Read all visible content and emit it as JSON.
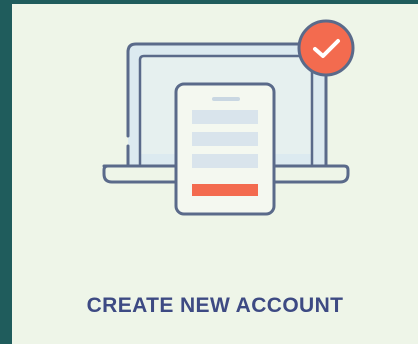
{
  "card": {
    "title": "CREATE NEW ACCOUNT",
    "illustration_icon": "laptop-with-signup-form-icon",
    "badge_icon": "checkmark-icon"
  },
  "colors": {
    "card_background": "#eef5e8",
    "edge": "#1f5c5c",
    "outline": "#5a6a8a",
    "screen_fill": "#dceaf0",
    "form_lines": "#d9e4ec",
    "accent": "#f36b4f",
    "title_text": "#3d4a83"
  }
}
